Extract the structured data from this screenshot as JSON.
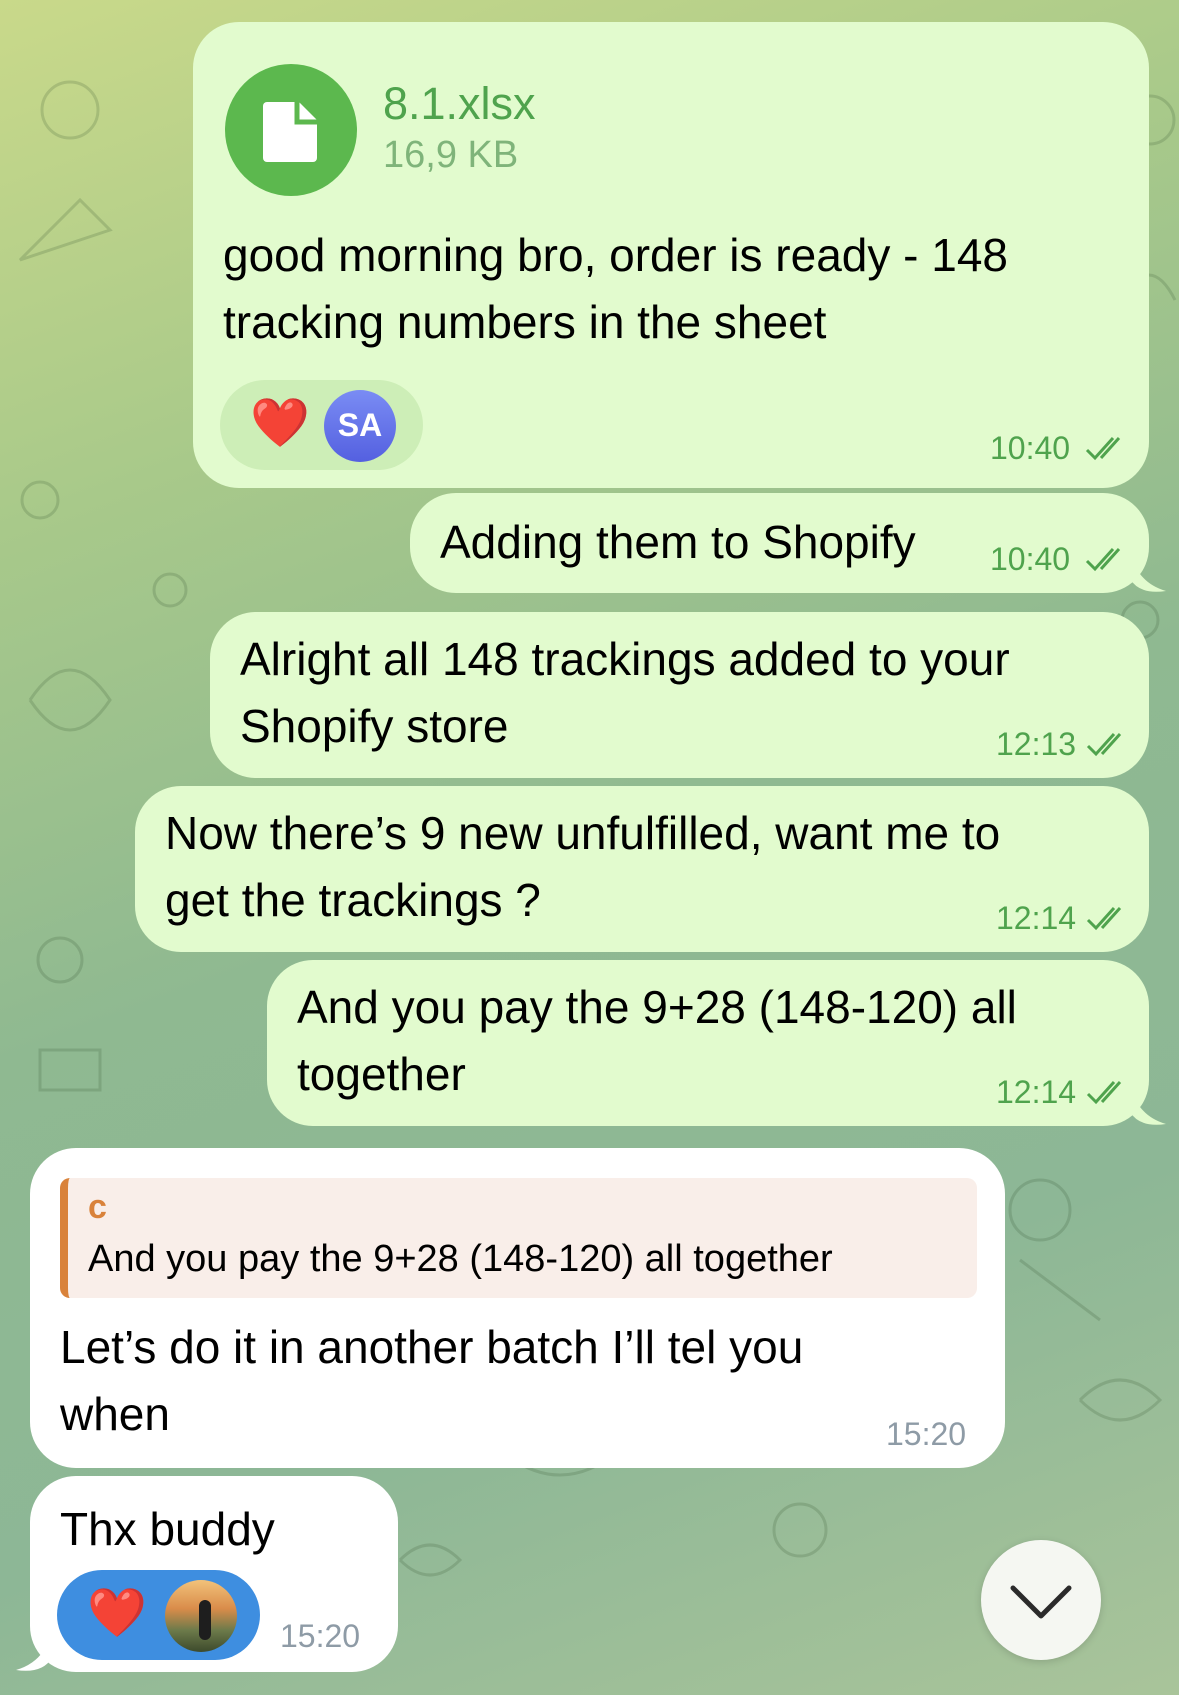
{
  "colors": {
    "outgoing_bubble": "#e2fbce",
    "incoming_bubble": "#ffffff",
    "accent_green": "#5cb84e",
    "meta_green": "#4fa34d",
    "reply_accent": "#d9823a",
    "reply_bg": "#f9eee9",
    "reaction_blue": "#3e8ee0"
  },
  "messages": [
    {
      "direction": "outgoing",
      "file": {
        "name": "8.1.xlsx",
        "size": "16,9 KB",
        "icon": "file-icon"
      },
      "text_lines": [
        "good morning bro, order is ready - 148",
        "tracking numbers in the sheet"
      ],
      "reaction": {
        "emoji": "❤️",
        "reactor_initials": "SA"
      },
      "time": "10:40",
      "status": "read"
    },
    {
      "direction": "outgoing",
      "text_lines": [
        "Adding them to Shopify"
      ],
      "time": "10:40",
      "status": "read"
    },
    {
      "direction": "outgoing",
      "text_lines": [
        "Alright all 148 trackings added to your",
        "Shopify store"
      ],
      "time": "12:13",
      "status": "read"
    },
    {
      "direction": "outgoing",
      "text_lines": [
        "Now there’s 9 new unfulfilled, want me to",
        "get the trackings ?"
      ],
      "time": "12:14",
      "status": "read"
    },
    {
      "direction": "outgoing",
      "text_lines": [
        "And you pay the 9+28 (148-120) all",
        "together"
      ],
      "time": "12:14",
      "status": "read"
    },
    {
      "direction": "incoming",
      "reply": {
        "author": "c",
        "text": "And you pay the 9+28 (148-120) all together"
      },
      "text_lines": [
        "Let’s do it in another batch I’ll tel you",
        "when"
      ],
      "time": "15:20"
    },
    {
      "direction": "incoming",
      "text_lines": [
        "Thx buddy"
      ],
      "reaction": {
        "emoji": "❤️",
        "reactor": "avatar"
      },
      "time": "15:20"
    }
  ],
  "scroll_button": {
    "icon": "chevron-down-icon"
  }
}
